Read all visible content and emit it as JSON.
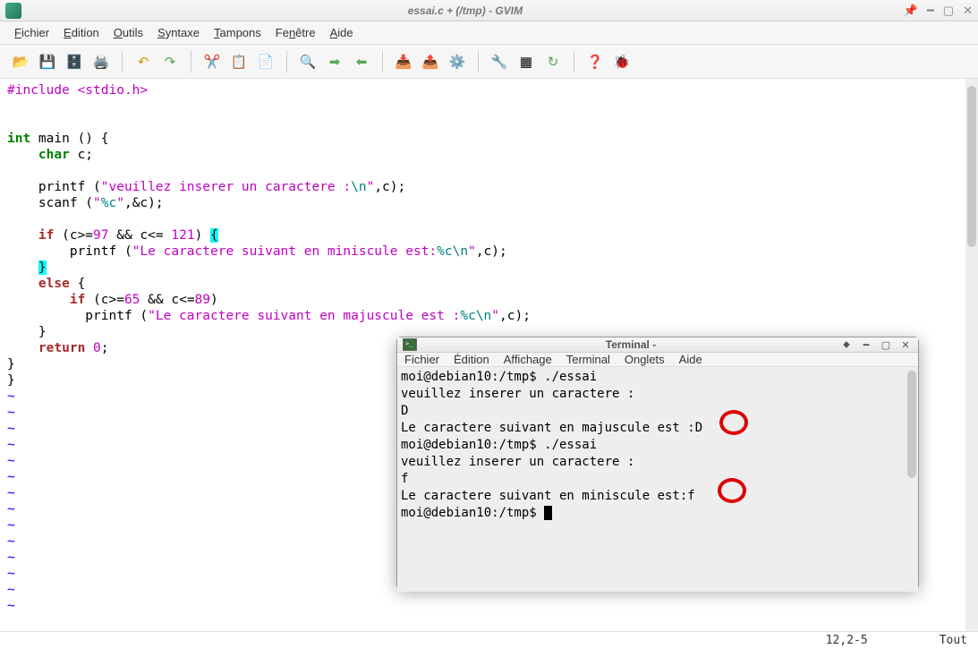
{
  "gvim": {
    "title": "essai.c + (/tmp) - GVIM",
    "menus": [
      "Fichier",
      "Edition",
      "Outils",
      "Syntaxe",
      "Tampons",
      "Fenêtre",
      "Aide"
    ],
    "status": {
      "pos": "12,2-5",
      "mode": "Tout"
    }
  },
  "code": {
    "l1a": "#include ",
    "l1b": "<stdio.h>",
    "l2": "",
    "l3": "",
    "l4a": "int",
    "l4b": " main () {",
    "l5a": "    ",
    "l5b": "char",
    "l5c": " c;",
    "l6": "",
    "l7a": "    printf (",
    "l7b": "\"veuillez inserer un caractere :",
    "l7fmt": "\\n",
    "l7c": "\"",
    "l7d": ",c);",
    "l8a": "    scanf (",
    "l8b": "\"",
    "l8fmt": "%c",
    "l8c": "\"",
    "l8d": ",&c);",
    "l9": "",
    "l10a": "    ",
    "l10b": "if",
    "l10c": " (c>=",
    "l10n1": "97",
    "l10d": " && c<= ",
    "l10n2": "121",
    "l10e": ") ",
    "l10f": "{",
    "l11a": "        printf (",
    "l11b": "\"Le caractere suivant en miniscule est:",
    "l11fmt1": "%c",
    "l11fmt2": "\\n",
    "l11c": "\"",
    "l11d": ",c);",
    "l12a": "    ",
    "l12b": "}",
    "l13a": "    ",
    "l13b": "else",
    "l13c": " {",
    "l14a": "        ",
    "l14b": "if",
    "l14c": " (c>=",
    "l14n1": "65",
    "l14d": " && c<=",
    "l14n2": "89",
    "l14e": ")",
    "l15a": "          printf (",
    "l15b": "\"Le caractere suivant en majuscule est :",
    "l15fmt1": "%c",
    "l15fmt2": "\\n",
    "l15c": "\"",
    "l15d": ",c);",
    "l16": "    }",
    "l17a": "    ",
    "l17b": "return",
    "l17c": " ",
    "l17n": "0",
    "l17d": ";",
    "l18": "}",
    "l19": "}"
  },
  "terminal": {
    "title": "Terminal -",
    "menus": [
      "Fichier",
      "Édition",
      "Affichage",
      "Terminal",
      "Onglets",
      "Aide"
    ],
    "lines": {
      "l1": "moi@debian10:/tmp$ ./essai",
      "l2": "veuillez inserer un caractere :",
      "l3": "D",
      "l4": "Le caractere suivant en majuscule est :D",
      "l5": "moi@debian10:/tmp$ ./essai",
      "l6": "veuillez inserer un caractere :",
      "l7": "f",
      "l8": "Le caractere suivant en miniscule est:f",
      "l9": "moi@debian10:/tmp$ "
    }
  }
}
